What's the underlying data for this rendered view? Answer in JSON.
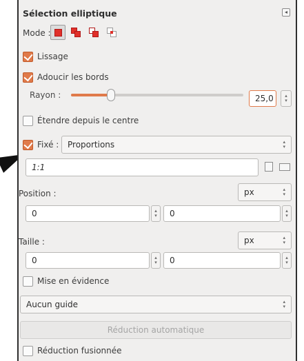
{
  "panel": {
    "title": "Sélection elliptique",
    "collapse_icon": "collapse-left-icon"
  },
  "mode": {
    "label": "Mode :",
    "options": [
      {
        "name": "replace",
        "active": true
      },
      {
        "name": "add",
        "active": false
      },
      {
        "name": "subtract",
        "active": false
      },
      {
        "name": "intersect",
        "active": false
      }
    ]
  },
  "lissage": {
    "label": "Lissage",
    "checked": true
  },
  "adoucir": {
    "label": "Adoucir les bords",
    "checked": true
  },
  "rayon": {
    "label": "Rayon :",
    "value": "25,0",
    "slider_fraction": 0.23
  },
  "etendre": {
    "label": "Étendre depuis le centre",
    "checked": false
  },
  "fixe": {
    "label": "Fixé :",
    "checked": true,
    "selected": "Proportions",
    "value": "1:1"
  },
  "position": {
    "label": "Position :",
    "unit": "px",
    "x": "0",
    "y": "0"
  },
  "taille": {
    "label": "Taille :",
    "unit": "px",
    "w": "0",
    "h": "0"
  },
  "mise_en_evidence": {
    "label": "Mise en évidence",
    "checked": false
  },
  "guide": {
    "selected": "Aucun guide"
  },
  "auto_shrink": {
    "label": "Réduction automatique"
  },
  "reduction_fusionnee": {
    "label": "Réduction fusionnée",
    "checked": false
  },
  "colors": {
    "accent": "#e07a4a",
    "panel_bg": "#f0efee"
  }
}
